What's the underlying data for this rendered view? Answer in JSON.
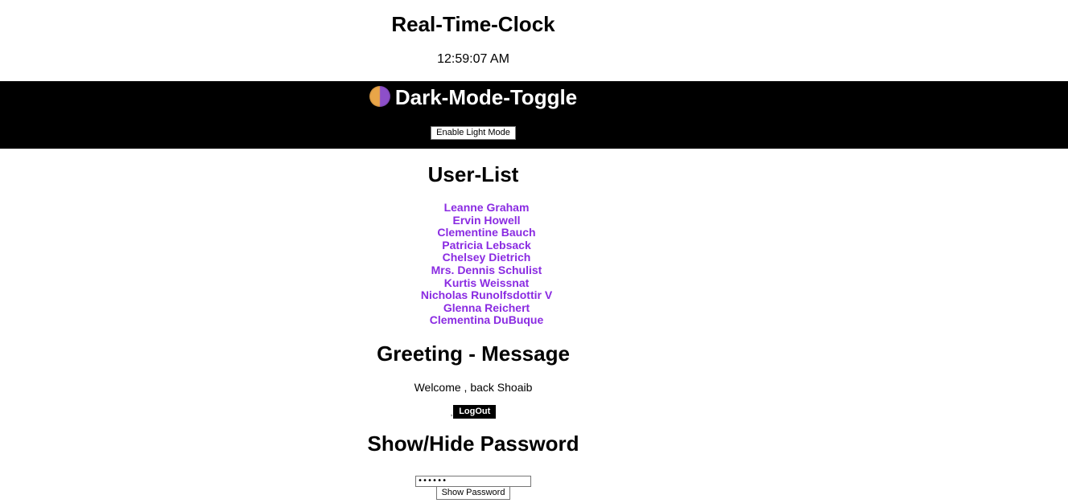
{
  "clock": {
    "title": "Real-Time-Clock",
    "time": "12:59:07 AM"
  },
  "dark_mode": {
    "title": "Dark-Mode-Toggle",
    "icon": "moon-icon",
    "button_label": "Enable Light Mode",
    "band_color": "#000000"
  },
  "users": {
    "title": "User-List",
    "link_color": "#8a2be2",
    "items": [
      "Leanne Graham",
      "Ervin Howell",
      "Clementine Bauch",
      "Patricia Lebsack",
      "Chelsey Dietrich",
      "Mrs. Dennis Schulist",
      "Kurtis Weissnat",
      "Nicholas Runolfsdottir V",
      "Glenna Reichert",
      "Clementina DuBuque"
    ]
  },
  "greeting": {
    "title": "Greeting - Message",
    "message": "Welcome , back Shoaib",
    "prefix": ",",
    "logout_label": "LogOut"
  },
  "password": {
    "title": "Show/Hide Password",
    "value": "••••••",
    "button_label": "Show Password"
  }
}
